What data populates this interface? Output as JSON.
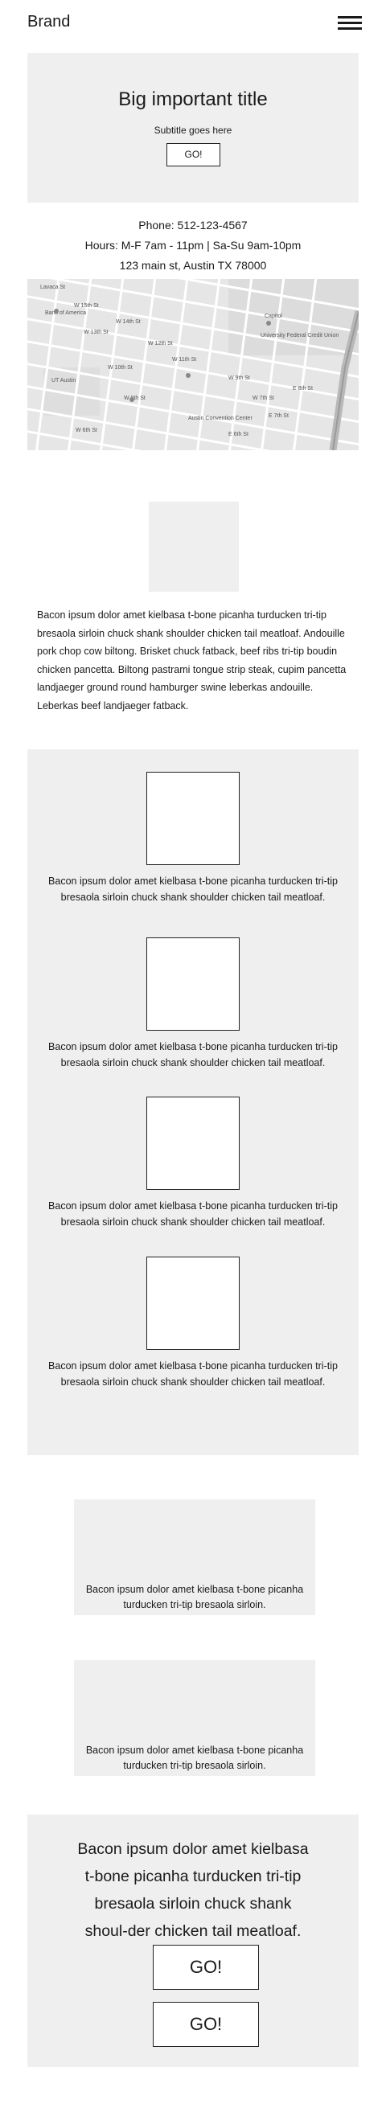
{
  "header": {
    "brand": "Brand",
    "menu_icon": "hamburger-menu-icon"
  },
  "hero": {
    "title": "Big important title",
    "subtitle": "Subtitle goes here",
    "button_label": "GO!"
  },
  "contact": {
    "phone": "Phone: 512-123-4567",
    "hours": "Hours: M-F 7am - 11pm | Sa-Su 9am-10pm",
    "address": "123 main st, Austin TX 78000"
  },
  "map": {
    "labels": [
      "W 15th St",
      "W 14th St",
      "W 13th St",
      "W 12th St",
      "W 11th St",
      "W 10th St",
      "W 9th St",
      "W 8th St",
      "W 7th St",
      "W 6th St",
      "E 7th St",
      "E 8th St",
      "E 6th St",
      "Lavaca St",
      "Capitol",
      "Bank of America",
      "University Federal Credit Union",
      "UT Austin",
      "Austin Convention Center"
    ]
  },
  "intro": {
    "text": "Bacon ipsum dolor amet kielbasa t-bone picanha turducken tri-tip bresaola sirloin chuck shank shoulder chicken tail meatloaf. Andouille pork chop cow biltong. Brisket chuck fatback, beef ribs tri-tip boudin chicken pancetta. Biltong pastrami tongue strip steak, cupim pancetta landjaeger ground round hamburger swine leberkas andouille. Leberkas beef landjaeger fatback."
  },
  "features": [
    {
      "text": "Bacon ipsum dolor amet kielbasa t-bone picanha turducken tri-tip bresaola sirloin chuck shank shoulder chicken tail meatloaf."
    },
    {
      "text": "Bacon ipsum dolor amet kielbasa t-bone picanha turducken tri-tip bresaola sirloin chuck shank shoulder chicken tail meatloaf."
    },
    {
      "text": "Bacon ipsum dolor amet kielbasa t-bone picanha turducken tri-tip bresaola sirloin chuck shank shoulder chicken tail meatloaf."
    },
    {
      "text": "Bacon ipsum dolor amet kielbasa t-bone picanha turducken tri-tip bresaola sirloin chuck shank shoulder chicken tail meatloaf."
    }
  ],
  "cards": [
    {
      "text": "Bacon ipsum dolor amet kielbasa t-bone picanha turducken tri-tip bresaola sirloin."
    },
    {
      "text": "Bacon ipsum dolor amet kielbasa t-bone picanha turducken tri-tip bresaola sirloin."
    }
  ],
  "cta": {
    "text": "Bacon ipsum dolor amet kielbasa t-bone picanha turducken tri-tip bresaola sirloin chuck shank shoul-der chicken tail meatloaf.",
    "button1_label": "GO!",
    "button2_label": "GO!"
  },
  "colors": {
    "panel": "#efefef",
    "text": "#1a1a1a",
    "border": "#222222"
  }
}
